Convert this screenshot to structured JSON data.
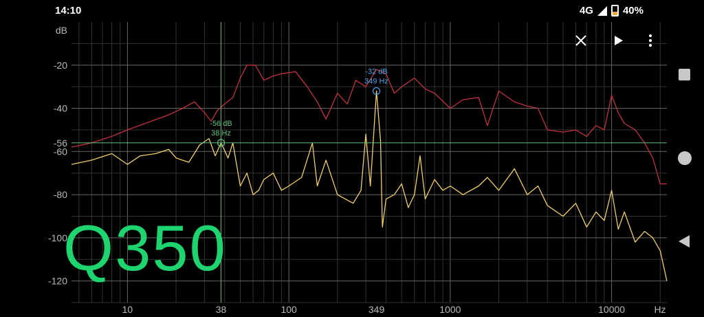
{
  "status": {
    "time": "14:10",
    "network": "4G",
    "battery": "40%"
  },
  "overlay_text": "Q350",
  "toolbar": {
    "close_icon": "close-icon",
    "play_icon": "play-icon",
    "menu_icon": "more-vert-icon"
  },
  "nav": {
    "recents": "square",
    "home": "circle",
    "back": "triangle"
  },
  "chart_data": {
    "type": "line",
    "title": "",
    "xlabel": "Hz",
    "ylabel": "dB",
    "xscale": "log",
    "xlim": [
      4.5,
      22000
    ],
    "ylim": [
      -130,
      0
    ],
    "x_ticks": [
      10,
      38,
      100,
      349,
      1000,
      10000
    ],
    "x_tick_labels": [
      "10",
      "38",
      "100",
      "349",
      "1000",
      "10000"
    ],
    "y_ticks": [
      -20,
      -40,
      -56,
      -60,
      -80,
      -100,
      -120
    ],
    "y_tick_labels": [
      "-20",
      "-40",
      "-56",
      "-60",
      "-80",
      "-100",
      "-120"
    ],
    "grid": true,
    "cursors": [
      {
        "x": 38,
        "y": -56,
        "label_db": "-56 dB",
        "label_hz": "38 Hz",
        "color": "#5ec27a"
      },
      {
        "x": 349,
        "y": -32,
        "label_db": "-32 dB",
        "label_hz": "349 Hz",
        "color": "#4aa3e8"
      }
    ],
    "series": [
      {
        "color": "#c4303d",
        "points": [
          [
            4.5,
            -58
          ],
          [
            6,
            -56
          ],
          [
            8,
            -53
          ],
          [
            10,
            -50
          ],
          [
            14,
            -46
          ],
          [
            18,
            -43
          ],
          [
            22,
            -40
          ],
          [
            26,
            -37
          ],
          [
            30,
            -42
          ],
          [
            33,
            -46
          ],
          [
            36,
            -41
          ],
          [
            40,
            -38
          ],
          [
            45,
            -35
          ],
          [
            50,
            -26
          ],
          [
            55,
            -20
          ],
          [
            62,
            -20
          ],
          [
            70,
            -27
          ],
          [
            80,
            -25
          ],
          [
            90,
            -24
          ],
          [
            110,
            -23
          ],
          [
            130,
            -30
          ],
          [
            150,
            -37
          ],
          [
            170,
            -45
          ],
          [
            200,
            -33
          ],
          [
            230,
            -38
          ],
          [
            260,
            -27
          ],
          [
            300,
            -30
          ],
          [
            349,
            -22
          ],
          [
            400,
            -24
          ],
          [
            450,
            -33
          ],
          [
            500,
            -30
          ],
          [
            600,
            -26
          ],
          [
            700,
            -31
          ],
          [
            800,
            -33
          ],
          [
            1000,
            -40
          ],
          [
            1200,
            -36
          ],
          [
            1500,
            -35
          ],
          [
            1700,
            -48
          ],
          [
            2000,
            -32
          ],
          [
            2500,
            -37
          ],
          [
            3000,
            -39
          ],
          [
            3500,
            -40
          ],
          [
            4000,
            -50
          ],
          [
            5000,
            -51
          ],
          [
            6000,
            -50
          ],
          [
            7000,
            -53
          ],
          [
            8000,
            -48
          ],
          [
            9000,
            -50
          ],
          [
            10000,
            -34
          ],
          [
            11000,
            -42
          ],
          [
            12000,
            -47
          ],
          [
            14000,
            -50
          ],
          [
            16000,
            -56
          ],
          [
            18000,
            -63
          ],
          [
            20000,
            -75
          ],
          [
            22000,
            -75
          ]
        ]
      },
      {
        "color": "#f2d166",
        "points": [
          [
            4.5,
            -66
          ],
          [
            6,
            -64
          ],
          [
            8,
            -61
          ],
          [
            10,
            -66
          ],
          [
            12,
            -62
          ],
          [
            15,
            -61
          ],
          [
            18,
            -59
          ],
          [
            20,
            -63
          ],
          [
            24,
            -65
          ],
          [
            28,
            -57
          ],
          [
            32,
            -54
          ],
          [
            35,
            -62
          ],
          [
            38,
            -56
          ],
          [
            42,
            -63
          ],
          [
            45,
            -56
          ],
          [
            50,
            -76
          ],
          [
            55,
            -70
          ],
          [
            60,
            -80
          ],
          [
            65,
            -78
          ],
          [
            70,
            -73
          ],
          [
            80,
            -70
          ],
          [
            90,
            -78
          ],
          [
            100,
            -76
          ],
          [
            120,
            -72
          ],
          [
            140,
            -56
          ],
          [
            150,
            -76
          ],
          [
            170,
            -64
          ],
          [
            200,
            -80
          ],
          [
            250,
            -84
          ],
          [
            280,
            -78
          ],
          [
            300,
            -52
          ],
          [
            320,
            -76
          ],
          [
            349,
            -32
          ],
          [
            370,
            -55
          ],
          [
            380,
            -95
          ],
          [
            400,
            -82
          ],
          [
            450,
            -80
          ],
          [
            500,
            -75
          ],
          [
            550,
            -86
          ],
          [
            600,
            -80
          ],
          [
            650,
            -62
          ],
          [
            700,
            -82
          ],
          [
            800,
            -73
          ],
          [
            900,
            -78
          ],
          [
            1000,
            -76
          ],
          [
            1200,
            -80
          ],
          [
            1500,
            -76
          ],
          [
            1700,
            -72
          ],
          [
            2000,
            -78
          ],
          [
            2500,
            -68
          ],
          [
            3000,
            -80
          ],
          [
            3500,
            -76
          ],
          [
            4000,
            -85
          ],
          [
            5000,
            -90
          ],
          [
            6000,
            -84
          ],
          [
            7000,
            -95
          ],
          [
            8000,
            -88
          ],
          [
            9000,
            -92
          ],
          [
            10000,
            -78
          ],
          [
            11000,
            -96
          ],
          [
            12000,
            -88
          ],
          [
            14000,
            -102
          ],
          [
            16000,
            -97
          ],
          [
            18000,
            -100
          ],
          [
            20000,
            -106
          ],
          [
            22000,
            -120
          ]
        ]
      }
    ]
  }
}
